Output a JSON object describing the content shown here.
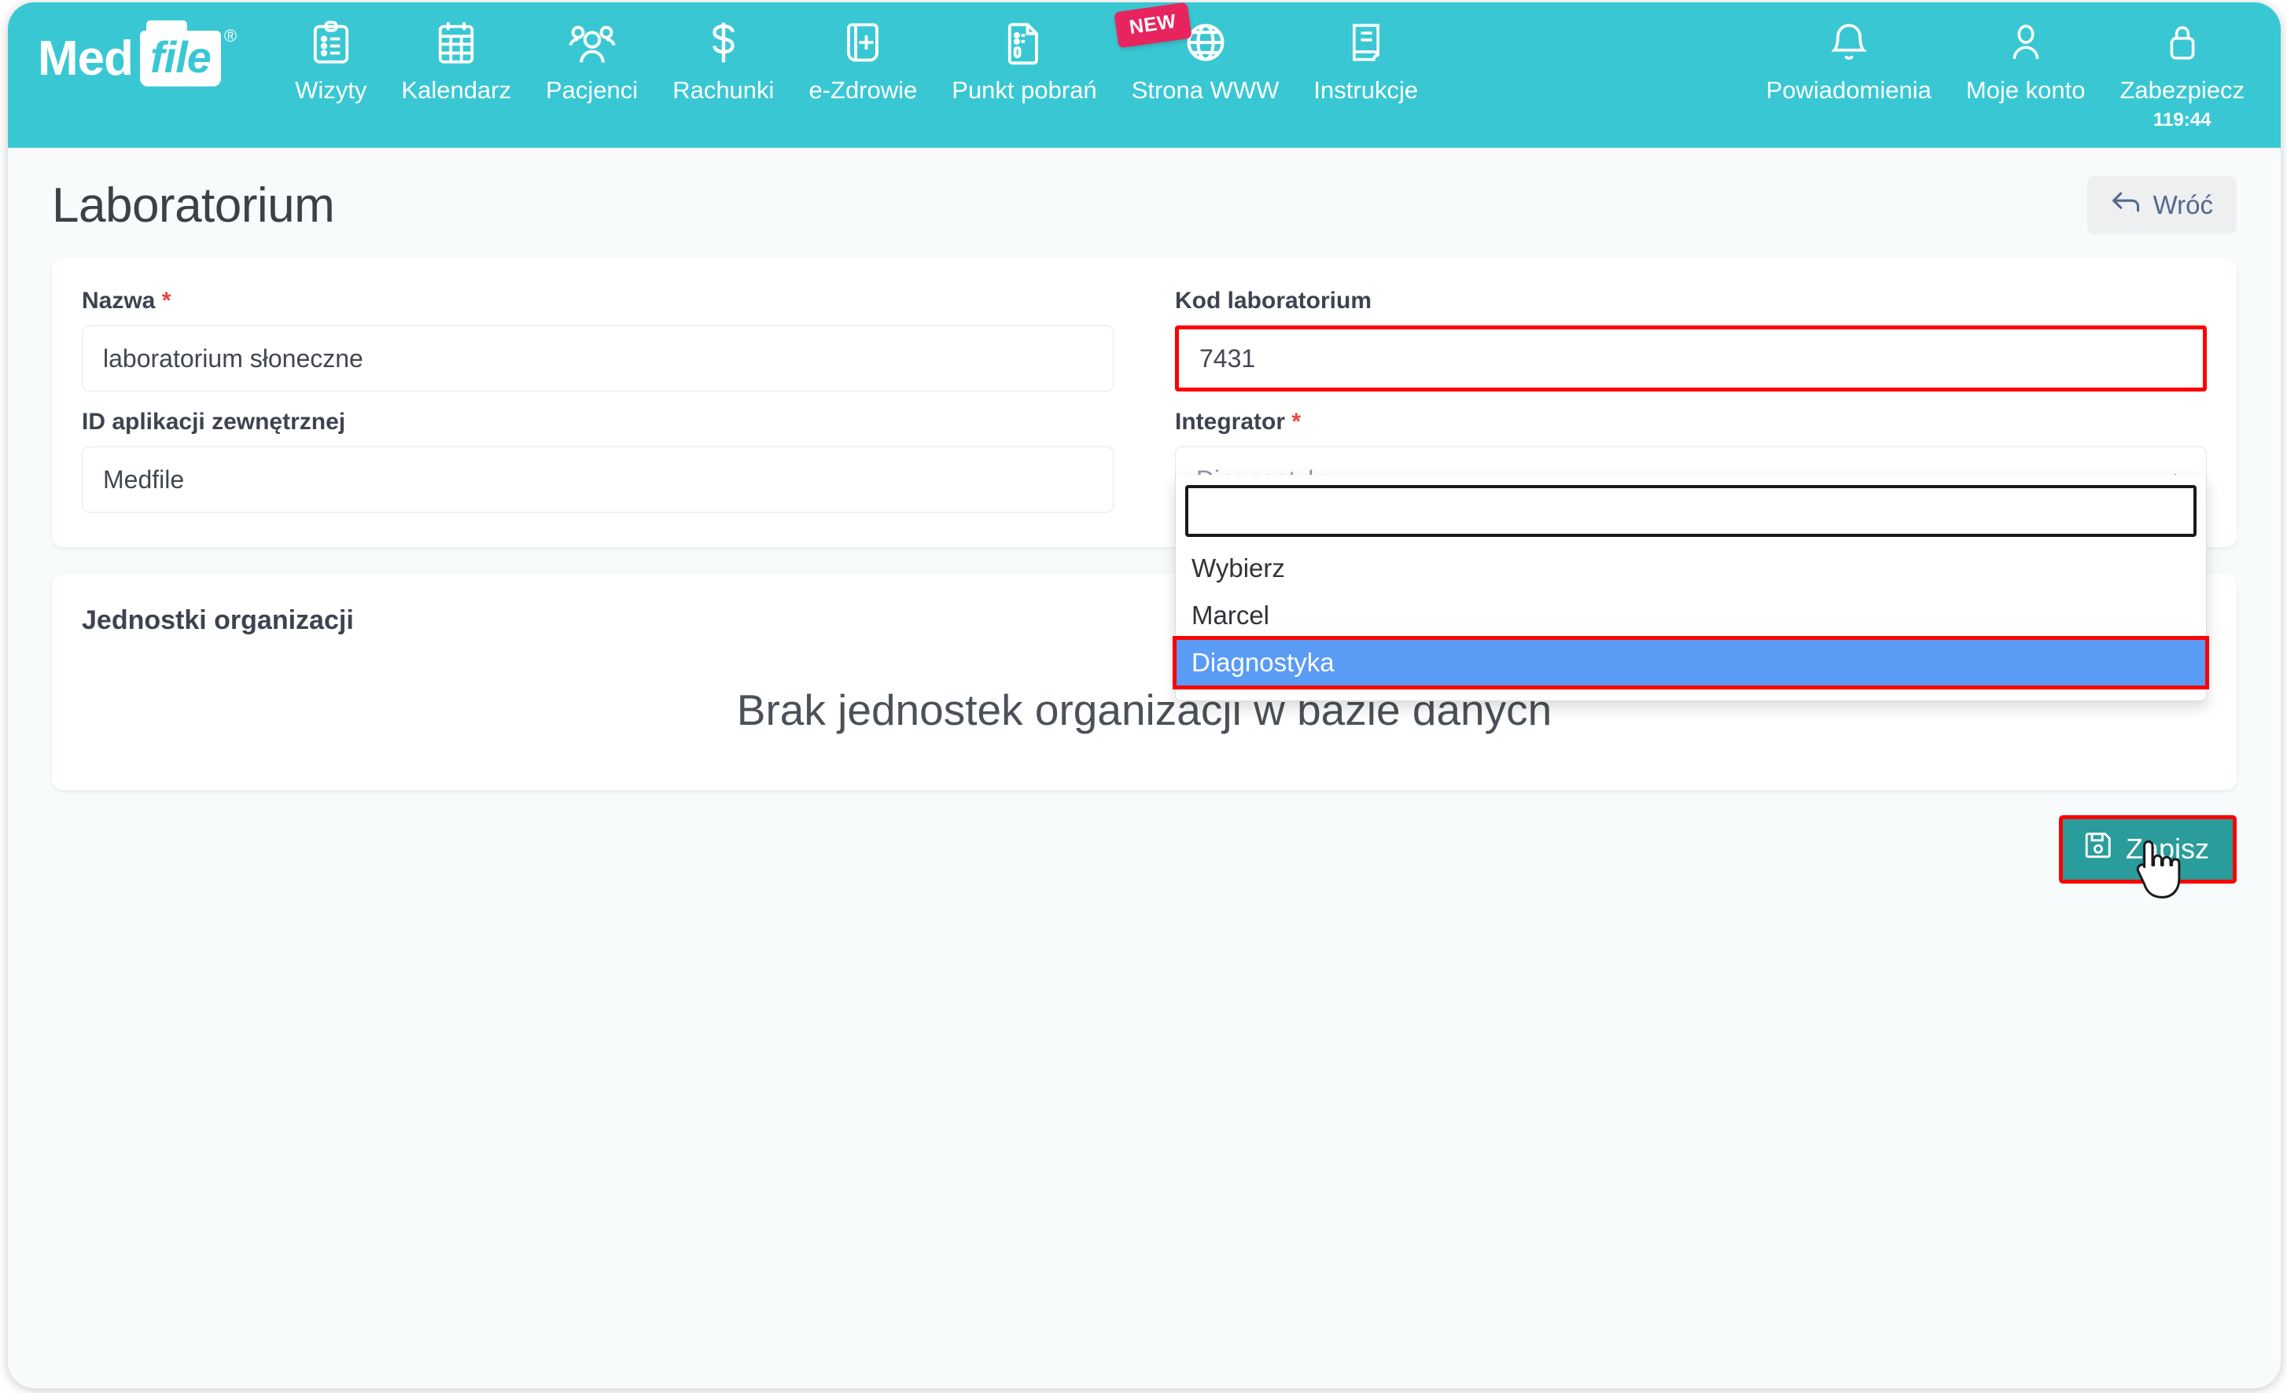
{
  "brand": {
    "logo_primary": "Med",
    "logo_secondary": "file",
    "logo_trademark": "®",
    "header_color": "#39c8d3"
  },
  "topnav": {
    "items": [
      {
        "label": "Wizyty",
        "icon": "clipboard-list-icon"
      },
      {
        "label": "Kalendarz",
        "icon": "calendar-icon"
      },
      {
        "label": "Pacjenci",
        "icon": "users-icon"
      },
      {
        "label": "Rachunki",
        "icon": "dollar-icon"
      },
      {
        "label": "e-Zdrowie",
        "icon": "medical-record-icon"
      },
      {
        "label": "Punkt pobrań",
        "icon": "document-test-icon"
      },
      {
        "label": "Strona WWW",
        "icon": "globe-icon",
        "badge": "NEW",
        "badge_color": "#e8245f"
      },
      {
        "label": "Instrukcje",
        "icon": "book-icon"
      }
    ],
    "right_items": [
      {
        "label": "Powiadomienia",
        "icon": "bell-icon"
      },
      {
        "label": "Moje konto",
        "icon": "user-icon"
      },
      {
        "label": "Zabezpiecz",
        "icon": "lock-icon",
        "timer": "119:44"
      }
    ]
  },
  "page": {
    "title": "Laboratorium",
    "back_label": "Wróć"
  },
  "form": {
    "name": {
      "label": "Nazwa",
      "required_mark": "*",
      "value": "laboratorium słoneczne",
      "placeholder": ""
    },
    "lab_code": {
      "label": "Kod laboratorium",
      "value": "7431",
      "placeholder": "",
      "highlight_color": "#ff0000"
    },
    "external_app_id": {
      "label": "ID aplikacji zewnętrznej",
      "value": "Medfile",
      "placeholder": ""
    },
    "integrator": {
      "label": "Integrator",
      "required_mark": "*",
      "selected": "Diagnostyka",
      "search_value": "",
      "search_placeholder": "",
      "options": [
        "Wybierz",
        "Marcel",
        "Diagnostyka"
      ],
      "highlighted_option": "Diagnostyka",
      "highlight_bg": "#5a9bf6",
      "annotation_color": "#ff0000"
    }
  },
  "units": {
    "title": "Jednostki organizacji",
    "empty_message": "Brak jednostek organizacji w bazie danych"
  },
  "actions": {
    "save_label": "Zapisz",
    "save_icon": "floppy-save-icon",
    "save_color": "#2b9c9c"
  }
}
